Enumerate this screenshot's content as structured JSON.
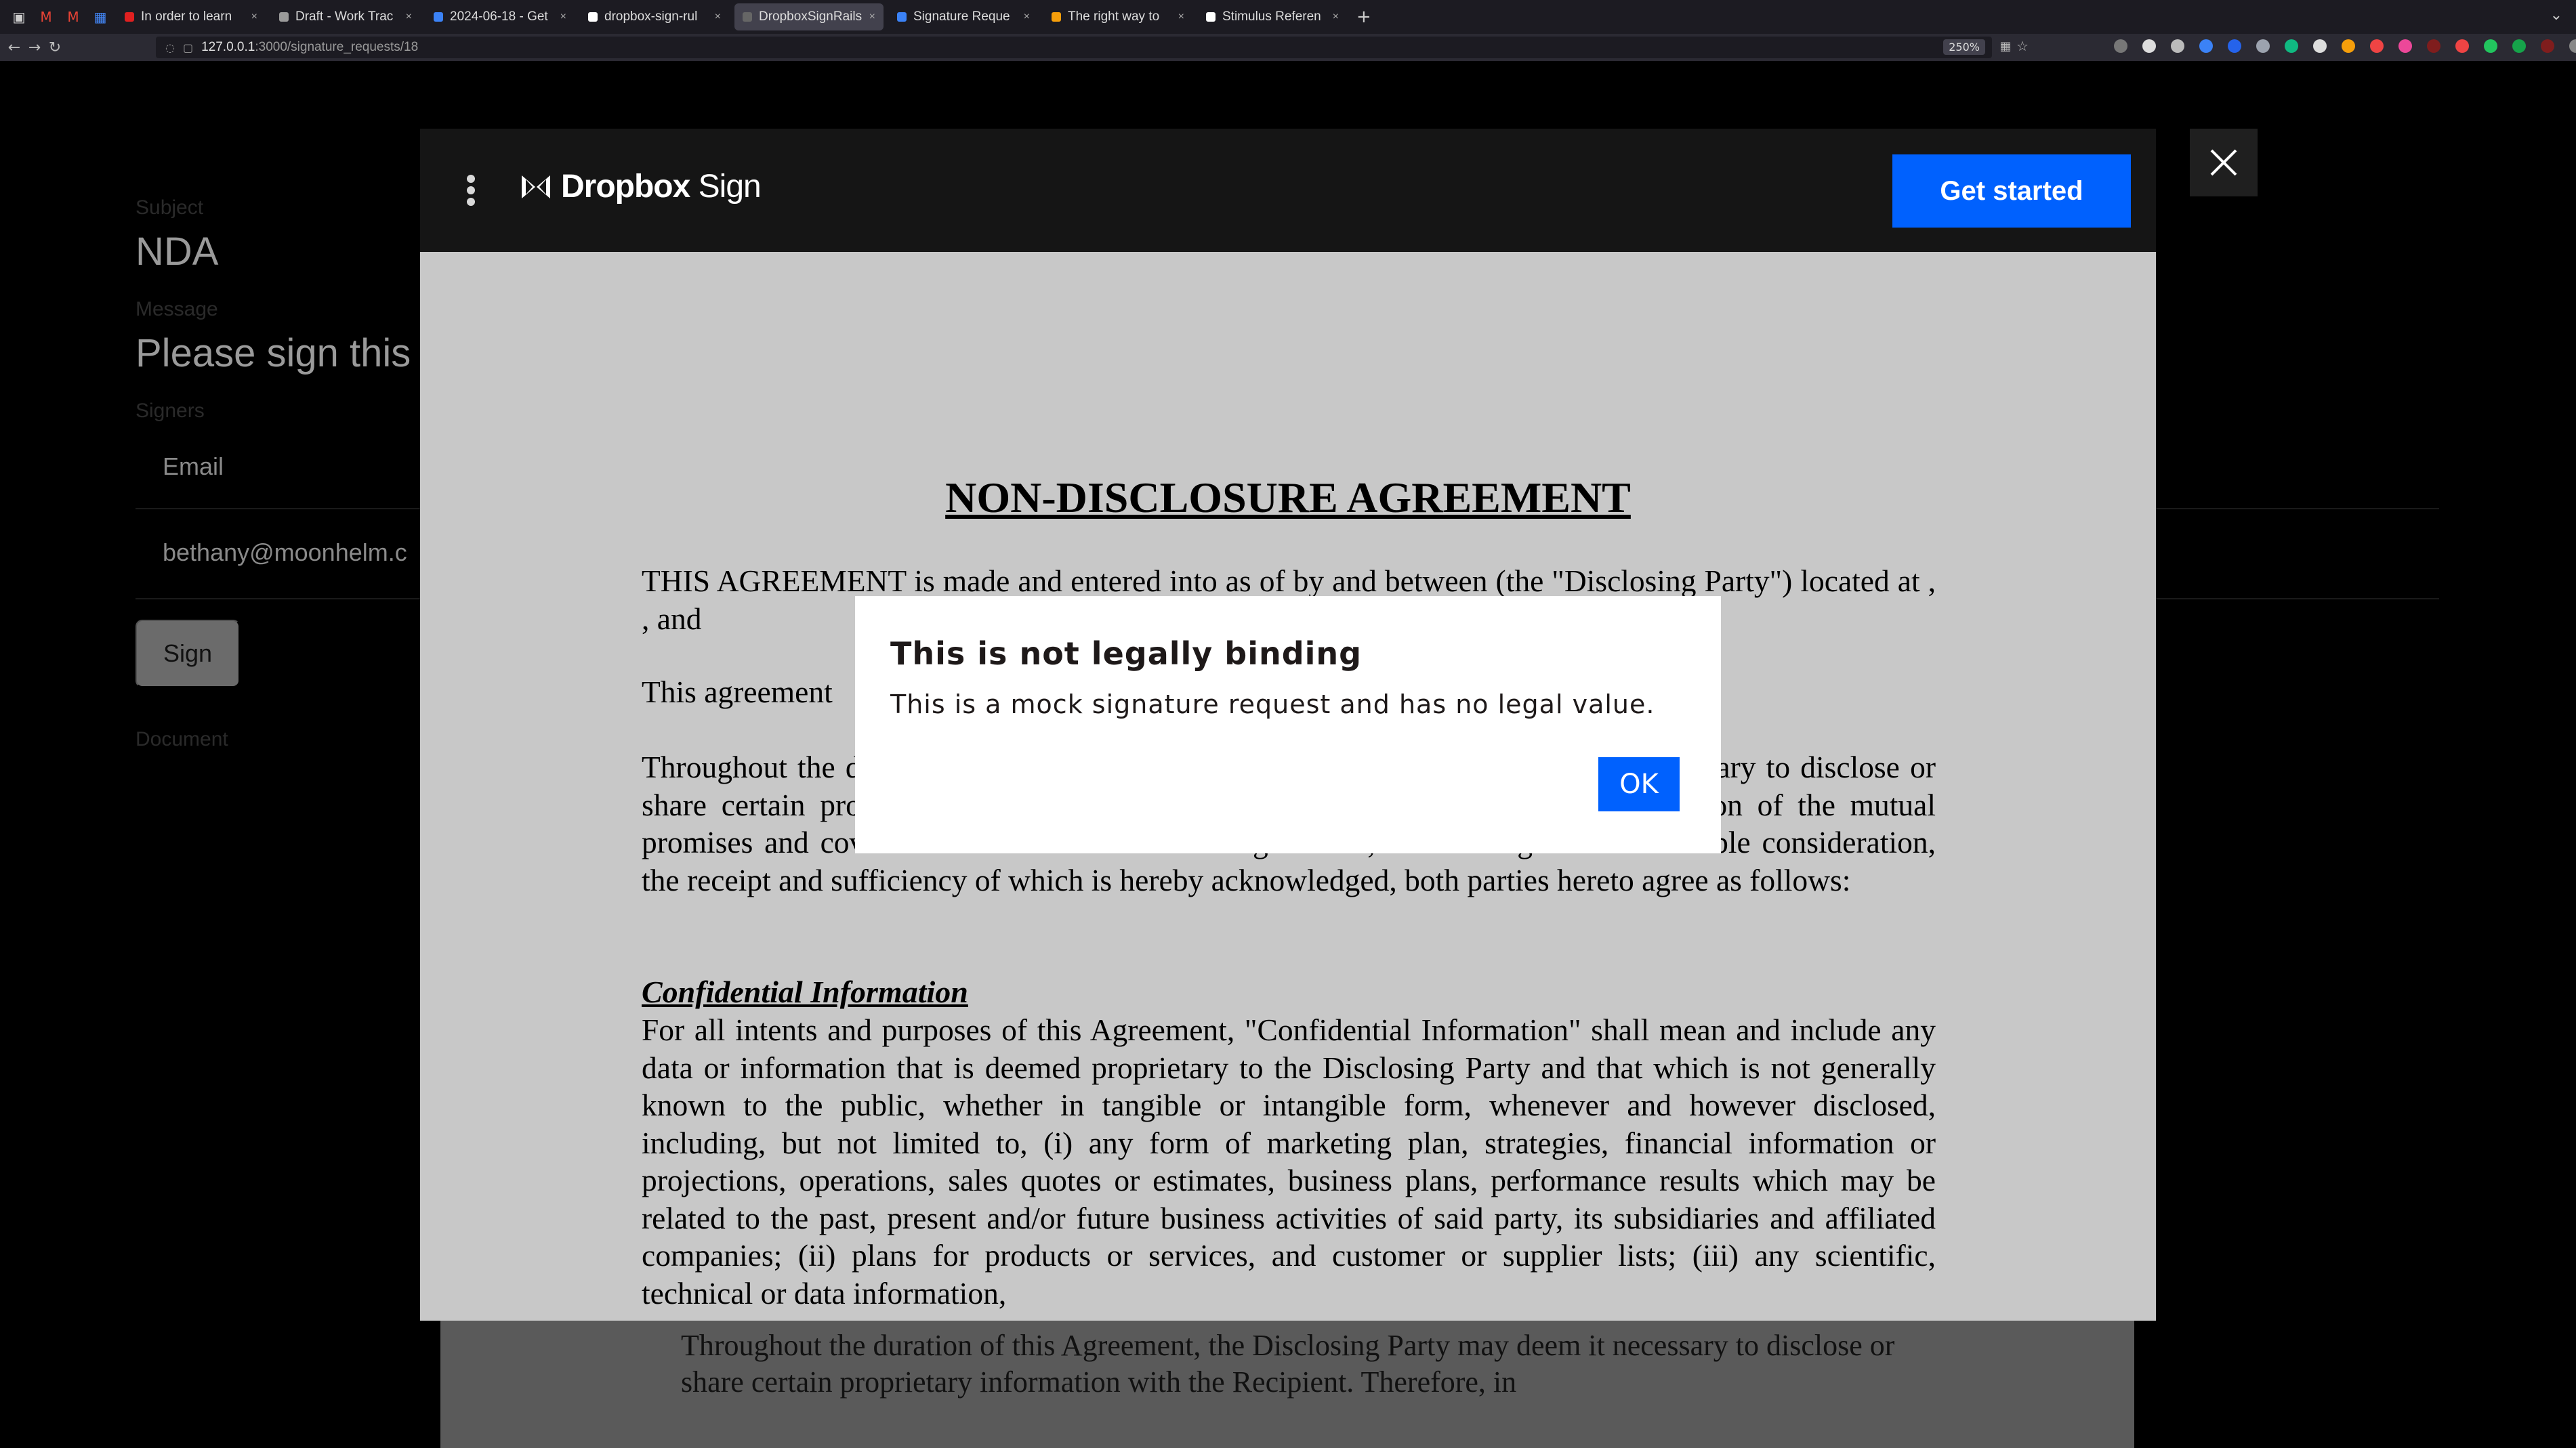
{
  "browser": {
    "tabs": [
      {
        "label": "In order to learn",
        "color": "#e02020"
      },
      {
        "label": "Draft - Work Trac",
        "color": "#9a9a9a"
      },
      {
        "label": "2024-06-18 - Get",
        "color": "#3b82f6"
      },
      {
        "label": "dropbox-sign-rul",
        "color": "#ffffff"
      },
      {
        "label": "DropboxSignRailsD",
        "color": "#666666"
      },
      {
        "label": "Signature Reque",
        "color": "#3b82f6"
      },
      {
        "label": "The right way to",
        "color": "#f59e0b"
      },
      {
        "label": "Stimulus Referen",
        "color": "#ffffff"
      }
    ],
    "url_host": "127.0.0.1",
    "url_path": ":3000/signature_requests/18",
    "zoom": "250%"
  },
  "page": {
    "subject_label": "Subject",
    "subject_value": "NDA",
    "message_label": "Message",
    "message_value": "Please sign this",
    "signers_label": "Signers",
    "email_header": "Email",
    "email_value": "bethany@moonhelm.c",
    "sign_button": "Sign",
    "document_label": "Document",
    "doc_peek": "Throughout the duration of this Agreement, the Disclosing Party may deem it necessary to disclose or share certain proprietary information with the Recipient. Therefore, in"
  },
  "modal": {
    "brand_main": "Dropbox",
    "brand_sub": " Sign",
    "get_started": "Get started",
    "doc": {
      "title": "NON-DISCLOSURE AGREEMENT",
      "para1": "THIS AGREEMENT is made and entered into as of by and between (the \"Disclosing Party\") located at , ,   and",
      "para2": "This agreement",
      "para3": "Throughout the duration of this Agreement, the Disclosing Party may deem it necessary to disclose or share certain proprietary information with the Recipient. Therefore, in consideration of the mutual promises and covenants contained within this Agreement, and other good and valuable consideration, the receipt and sufficiency of which is hereby acknowledged, both parties hereto agree as follows:",
      "heading1": "Confidential Information",
      "para4": "For all intents and purposes of this Agreement, \"Confidential Information\" shall mean and include any data or information that is deemed proprietary to the Disclosing Party and that which is not generally known to the public, whether in tangible or intangible form, whenever and however disclosed, including, but not limited to, (i) any form of marketing plan, strategies, financial information or projections, operations, sales quotes or estimates, business plans, performance results which may be related to the past, present and/or future business activities of said party, its subsidiaries and affiliated companies; (ii) plans for products or services, and customer or supplier lists; (iii) any scientific, technical or data information,"
    }
  },
  "alert": {
    "title": "This is not legally binding",
    "message": "This is a mock signature request and has no legal value.",
    "ok": "OK"
  }
}
